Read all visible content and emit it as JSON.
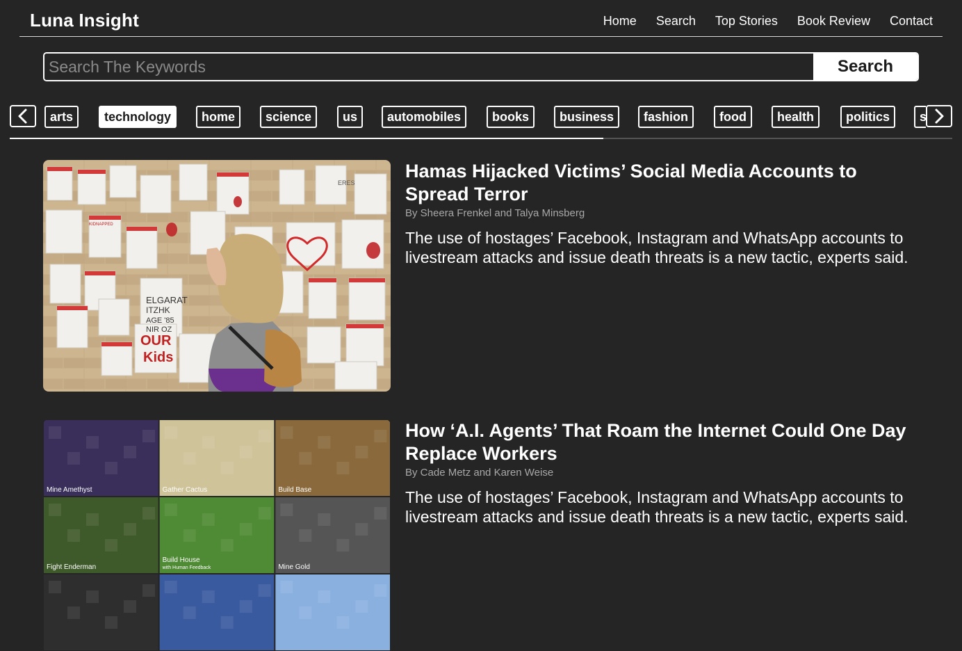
{
  "header": {
    "brand": "Luna Insight",
    "nav": [
      "Home",
      "Search",
      "Top Stories",
      "Book Review",
      "Contact"
    ]
  },
  "search": {
    "placeholder": "Search The Keywords",
    "value": "",
    "button_label": "Search"
  },
  "categories": {
    "items": [
      "arts",
      "technology",
      "home",
      "science",
      "us",
      "automobiles",
      "books",
      "business",
      "fashion",
      "food",
      "health",
      "politics",
      "s"
    ],
    "active": "technology",
    "scroll_position_fraction": 0.63
  },
  "articles": [
    {
      "title": "Hamas Hijacked Victims’ Social Media Accounts to Spread Terror",
      "byline": "By Sheera Frenkel and Talya Minsberg",
      "abstract": "The use of hostages’ Facebook, Instagram and WhatsApp accounts to livestream attacks and issue death threats is a new tactic, experts said.",
      "image": {
        "type": "photo",
        "wall_texts": [
          "KIDNAPPED",
          "OUR",
          "Kids",
          "ELGARAT",
          "ITZHK",
          "AGE '85",
          "NIR OZ",
          "ERES"
        ]
      }
    },
    {
      "title": "How ‘A.I. Agents’ That Roam the Internet Could One Day Replace Workers",
      "byline": "By Cade Metz and Karen Weise",
      "abstract": "The use of hostages’ Facebook, Instagram and WhatsApp accounts to livestream attacks and issue death threats is a new tactic, experts said.",
      "image": {
        "type": "grid",
        "tiles": [
          {
            "label": "Mine Amethyst",
            "sub": "",
            "color": "#3a2f5a"
          },
          {
            "label": "Gather Cactus",
            "sub": "",
            "color": "#cfc39a"
          },
          {
            "label": "Build Base",
            "sub": "",
            "color": "#8a6a3c"
          },
          {
            "label": "Fight Enderman",
            "sub": "",
            "color": "#3f5a2a"
          },
          {
            "label": "Build House",
            "sub": "with Human Feedback",
            "color": "#4f8a34"
          },
          {
            "label": "Mine Gold",
            "sub": "",
            "color": "#555555"
          },
          {
            "label": "",
            "sub": "",
            "color": "#2e2e2e"
          },
          {
            "label": "",
            "sub": "",
            "color": "#3a5aa0"
          },
          {
            "label": "",
            "sub": "",
            "color": "#8ab0e0"
          }
        ]
      }
    }
  ]
}
